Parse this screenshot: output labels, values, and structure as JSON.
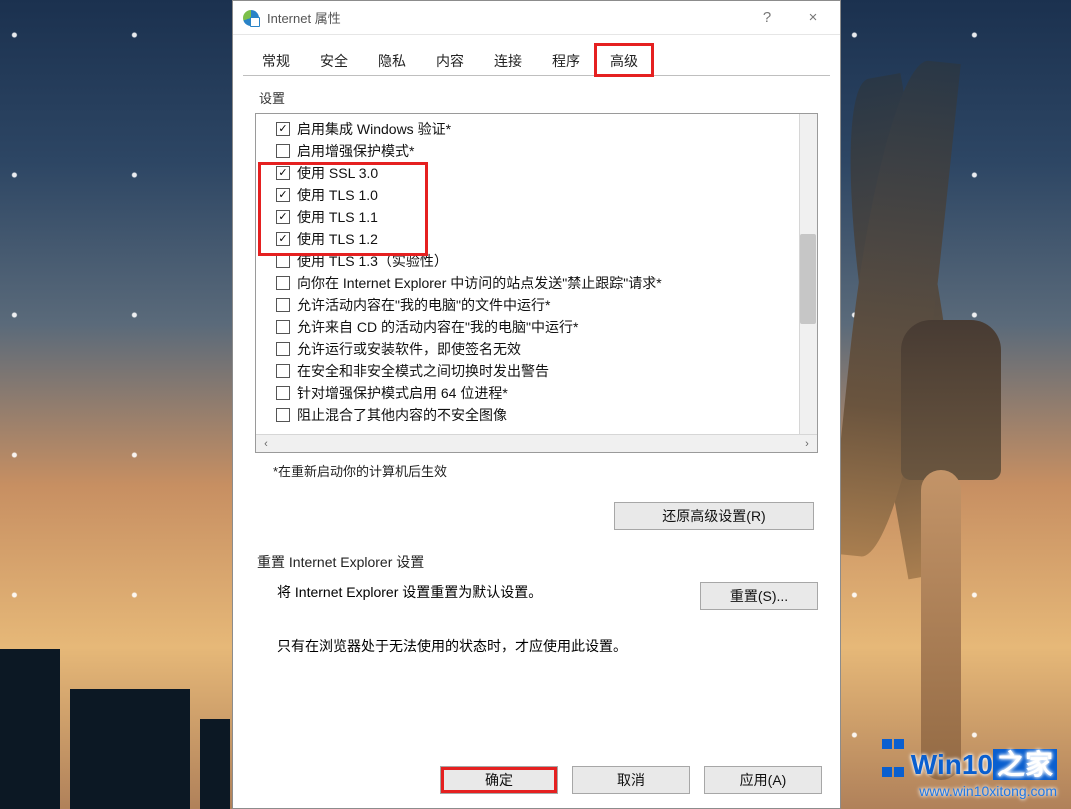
{
  "window": {
    "title": "Internet 属性",
    "help_label": "?",
    "close_label": "×"
  },
  "tabs": [
    "常规",
    "安全",
    "隐私",
    "内容",
    "连接",
    "程序",
    "高级"
  ],
  "active_tab_index": 6,
  "settings_group_label": "设置",
  "settings": [
    {
      "label": "启用集成 Windows 验证*",
      "checked": true
    },
    {
      "label": "启用增强保护模式*",
      "checked": false
    },
    {
      "label": "使用 SSL 3.0",
      "checked": true
    },
    {
      "label": "使用 TLS 1.0",
      "checked": true
    },
    {
      "label": "使用 TLS 1.1",
      "checked": true
    },
    {
      "label": "使用 TLS 1.2",
      "checked": true
    },
    {
      "label": "使用 TLS 1.3（实验性）",
      "checked": false
    },
    {
      "label": "向你在 Internet Explorer 中访问的站点发送\"禁止跟踪\"请求*",
      "checked": false
    },
    {
      "label": "允许活动内容在\"我的电脑\"的文件中运行*",
      "checked": false
    },
    {
      "label": "允许来自 CD 的活动内容在\"我的电脑\"中运行*",
      "checked": false
    },
    {
      "label": "允许运行或安装软件，即使签名无效",
      "checked": false
    },
    {
      "label": "在安全和非安全模式之间切换时发出警告",
      "checked": false
    },
    {
      "label": "针对增强保护模式启用 64 位进程*",
      "checked": false
    },
    {
      "label": "阻止混合了其他内容的不安全图像",
      "checked": false
    }
  ],
  "restart_note": "*在重新启动你的计算机后生效",
  "restore_button": "还原高级设置(R)",
  "reset_section_label": "重置 Internet Explorer 设置",
  "reset_description": "将 Internet Explorer 设置重置为默认设置。",
  "reset_button": "重置(S)...",
  "reset_warning": "只有在浏览器处于无法使用的状态时，才应使用此设置。",
  "buttons": {
    "ok": "确定",
    "cancel": "取消",
    "apply": "应用(A)"
  },
  "watermark": {
    "brand_prefix": "Win10",
    "brand_suffix": "之家",
    "url": "www.win10xitong.com"
  }
}
